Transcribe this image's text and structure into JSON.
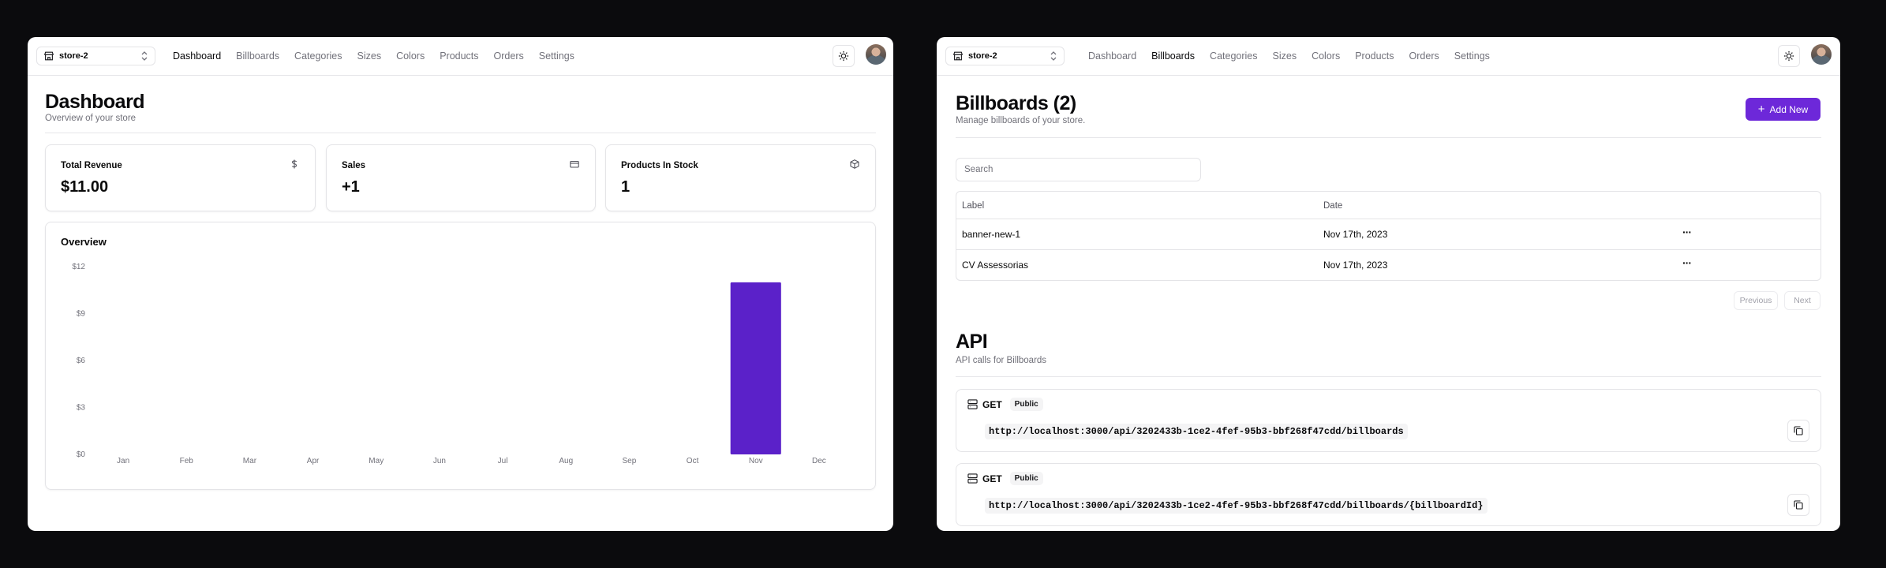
{
  "store_name": "store-2",
  "nav_items": [
    "Dashboard",
    "Billboards",
    "Categories",
    "Sizes",
    "Colors",
    "Products",
    "Orders",
    "Settings"
  ],
  "colors": {
    "accent": "#6d28d9",
    "bar": "#5b21c9",
    "border": "#e4e4e7",
    "muted": "#71717a"
  },
  "dashboard": {
    "title": "Dashboard",
    "subtitle": "Overview of your store",
    "stats": [
      {
        "label": "Total Revenue",
        "value": "$11.00",
        "icon": "dollar-icon"
      },
      {
        "label": "Sales",
        "value": "+1",
        "icon": "credit-card-icon"
      },
      {
        "label": "Products In Stock",
        "value": "1",
        "icon": "package-icon"
      }
    ],
    "overview_title": "Overview"
  },
  "chart_data": {
    "type": "bar",
    "title": "Overview",
    "categories": [
      "Jan",
      "Feb",
      "Mar",
      "Apr",
      "May",
      "Jun",
      "Jul",
      "Aug",
      "Sep",
      "Oct",
      "Nov",
      "Dec"
    ],
    "values": [
      0,
      0,
      0,
      0,
      0,
      0,
      0,
      0,
      0,
      0,
      11,
      0
    ],
    "y_ticks": [
      "$0",
      "$3",
      "$6",
      "$9",
      "$12"
    ],
    "ylim": [
      0,
      12
    ],
    "grid": false,
    "bar_color": "#5b21c9"
  },
  "billboards": {
    "title": "Billboards (2)",
    "subtitle": "Manage billboards of your store.",
    "add_button": "Add New",
    "search_placeholder": "Search",
    "columns": [
      "Label",
      "Date"
    ],
    "rows": [
      {
        "label": "banner-new-1",
        "date": "Nov 17th, 2023"
      },
      {
        "label": "CV Assessorias",
        "date": "Nov 17th, 2023"
      }
    ],
    "pagination": {
      "previous": "Previous",
      "next": "Next"
    }
  },
  "api": {
    "title": "API",
    "subtitle": "API calls for Billboards",
    "endpoints": [
      {
        "method": "GET",
        "access": "Public",
        "url": "http://localhost:3000/api/3202433b-1ce2-4fef-95b3-bbf268f47cdd/billboards"
      },
      {
        "method": "GET",
        "access": "Public",
        "url": "http://localhost:3000/api/3202433b-1ce2-4fef-95b3-bbf268f47cdd/billboards/{billboardId}"
      }
    ]
  }
}
